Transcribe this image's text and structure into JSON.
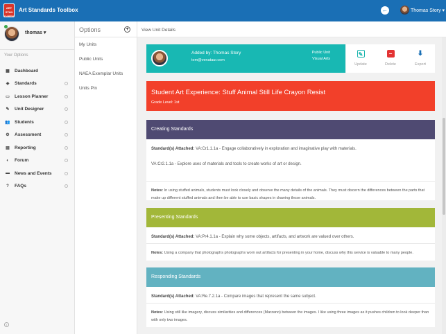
{
  "app": {
    "logo_text": "ART STAN DARDS",
    "title": "Art Standards Toolbox"
  },
  "topbar": {
    "user_name": "Thomas Story ▾"
  },
  "sidebar": {
    "user_name": "thomas ▾",
    "heading": "Your Options",
    "items": [
      {
        "label": "Dashboard",
        "icon": "▦"
      },
      {
        "label": "Standards",
        "icon": "◈"
      },
      {
        "label": "Lesson Planner",
        "icon": "▭"
      },
      {
        "label": "Unit Designer",
        "icon": "✎"
      },
      {
        "label": "Students",
        "icon": "👥"
      },
      {
        "label": "Assessment",
        "icon": "⚙"
      },
      {
        "label": "Reporting",
        "icon": "▤"
      },
      {
        "label": "Forum",
        "icon": "◐"
      },
      {
        "label": "News and Events",
        "icon": "▬"
      },
      {
        "label": "FAQs",
        "icon": "?"
      }
    ]
  },
  "options": {
    "title": "Options",
    "items": [
      "My Units",
      "Public Units",
      "NAEA Exemplar Units",
      "Units Pin"
    ]
  },
  "main": {
    "header": "View Unit Details",
    "added_by": "Added by: Thomas Story",
    "email": "tom@venataur.com",
    "badge_public": "Public Unit",
    "badge_subject": "Visual Arts",
    "actions": {
      "update": "Update",
      "delete": "Delete",
      "export": "Export"
    },
    "unit_title": "Student Art Experience: Stuff Animal Still Life Crayon Resist",
    "grade": "Grade Level: 1st",
    "creating": {
      "title": "Creating Standards",
      "attached_label": "Standard(s) Attached:",
      "standard_1": " VA:Cr1.1.1a - Engage collaboratively in exploration and imaginative play with materials.",
      "standard_2": "VA:Cr2.1.1a - Explore uses of materials and tools to create works of art or design.",
      "notes_label": "Notes:",
      "notes": " In using stuffed animals, students must look closely and observe the many details of the animals. They must discern the differences between the parts that make up different stuffed animals and then be able to use basic shapes in drawing those animals."
    },
    "presenting": {
      "title": "Presenting Standards",
      "attached_label": "Standard(s) Attached:",
      "standard_1": " VA:Pr4.1.1a - Explain why some objects, artifacts, and artwork are valued over others.",
      "notes_label": "Notes:",
      "notes": " Using a company that photographs photographs worn out artifacts for presenting in your home, discuss why this service is valuable to many people."
    },
    "responding": {
      "title": "Responding Standards",
      "attached_label": "Standard(s) Attached:",
      "standard_1": " VA:Re.7.2.1a - Compare images that represent the same subject.",
      "notes_label": "Notes:",
      "notes": " Using still like imagery, discuss similarities and differences (Marzano) between the images. I like using three images as it pushes children to look deeper than with only two images."
    }
  },
  "colors": {
    "topbar": "#1a6fb5",
    "profile_card": "#18b8b3",
    "title_card": "#f2402a",
    "creating": "#4f4a72",
    "presenting": "#a2b739",
    "responding": "#62b2c1"
  }
}
